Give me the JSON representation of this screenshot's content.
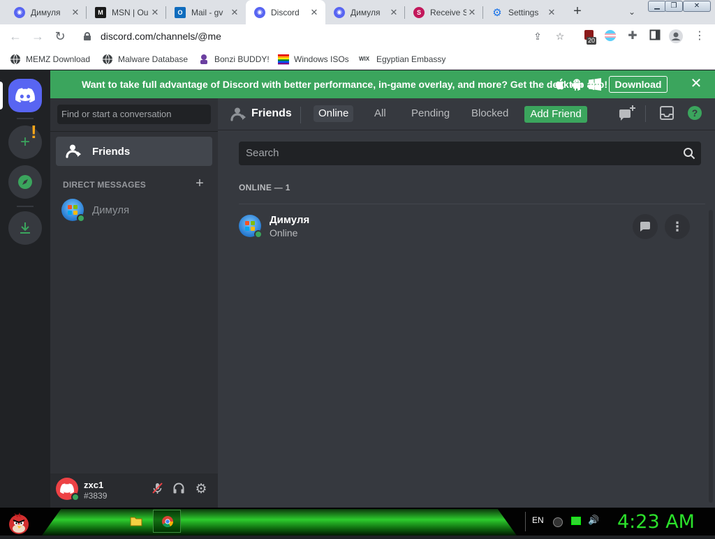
{
  "browser": {
    "tabs": [
      {
        "label": "Димуля",
        "icon": "discord-icon",
        "color": "#5865f2"
      },
      {
        "label": "MSN | Ou",
        "icon": "msn-icon",
        "color": "#1a1a1a"
      },
      {
        "label": "Mail - gv",
        "icon": "outlook-icon",
        "color": "#0f6cbd"
      },
      {
        "label": "Discord",
        "icon": "discord-icon",
        "color": "#5865f2"
      },
      {
        "label": "Димуля",
        "icon": "discord-icon",
        "color": "#5865f2"
      },
      {
        "label": "Receive S",
        "icon": "receive-sms-icon",
        "color": "#c2185b"
      },
      {
        "label": "Settings",
        "icon": "gear-icon",
        "color": "#1a73e8"
      }
    ],
    "url": "discord.com/channels/@me",
    "extension_badge": "20",
    "bookmarks": [
      {
        "label": "MEMZ Download"
      },
      {
        "label": "Malware Database"
      },
      {
        "label": "Bonzi BUDDY!"
      },
      {
        "label": "Windows ISOs"
      },
      {
        "label": "Egyptian Embassy"
      }
    ],
    "bookmark_wix_mark": "WIX"
  },
  "banner": {
    "text": "Want to take full advantage of Discord with better performance, in-game overlay, and more? Get the desktop app!",
    "download_label": "Download"
  },
  "sidebar": {
    "search_placeholder": "Find or start a conversation",
    "friends_label": "Friends",
    "dm_header": "DIRECT MESSAGES",
    "dms": [
      {
        "name": "Димуля"
      }
    ]
  },
  "user": {
    "name": "zxc1",
    "tag": "#3839"
  },
  "main": {
    "title": "Friends",
    "tabs": {
      "online": "Online",
      "all": "All",
      "pending": "Pending",
      "blocked": "Blocked",
      "add": "Add Friend"
    },
    "search_placeholder": "Search",
    "online_header": "ONLINE — 1",
    "friends": [
      {
        "name": "Димуля",
        "status": "Online"
      }
    ]
  },
  "taskbar": {
    "language": "EN",
    "clock": "4:23 AM"
  },
  "colors": {
    "accent": "#3ba55d",
    "blurple": "#5865f2",
    "background": "#36393f",
    "clock": "#2be02b"
  }
}
